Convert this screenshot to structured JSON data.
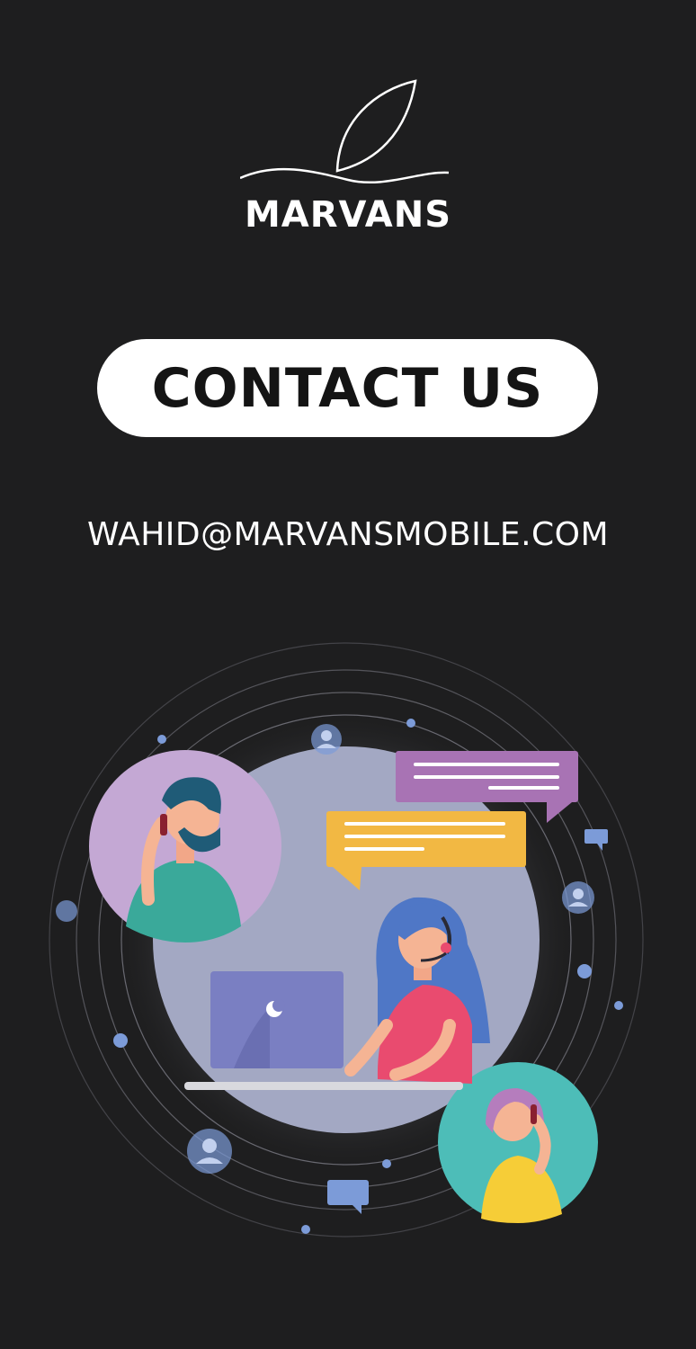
{
  "brand": {
    "name": "MARVANS"
  },
  "contact": {
    "button_label": "CONTACT US",
    "email": "WAHID@MARVANSMOBILE.COM"
  },
  "colors": {
    "background": "#1e1e1f",
    "button_bg": "#ffffff",
    "text": "#ffffff",
    "chat_purple": "#a873b4",
    "chat_yellow": "#f2b843",
    "dot_blue": "#7c9bd8"
  }
}
